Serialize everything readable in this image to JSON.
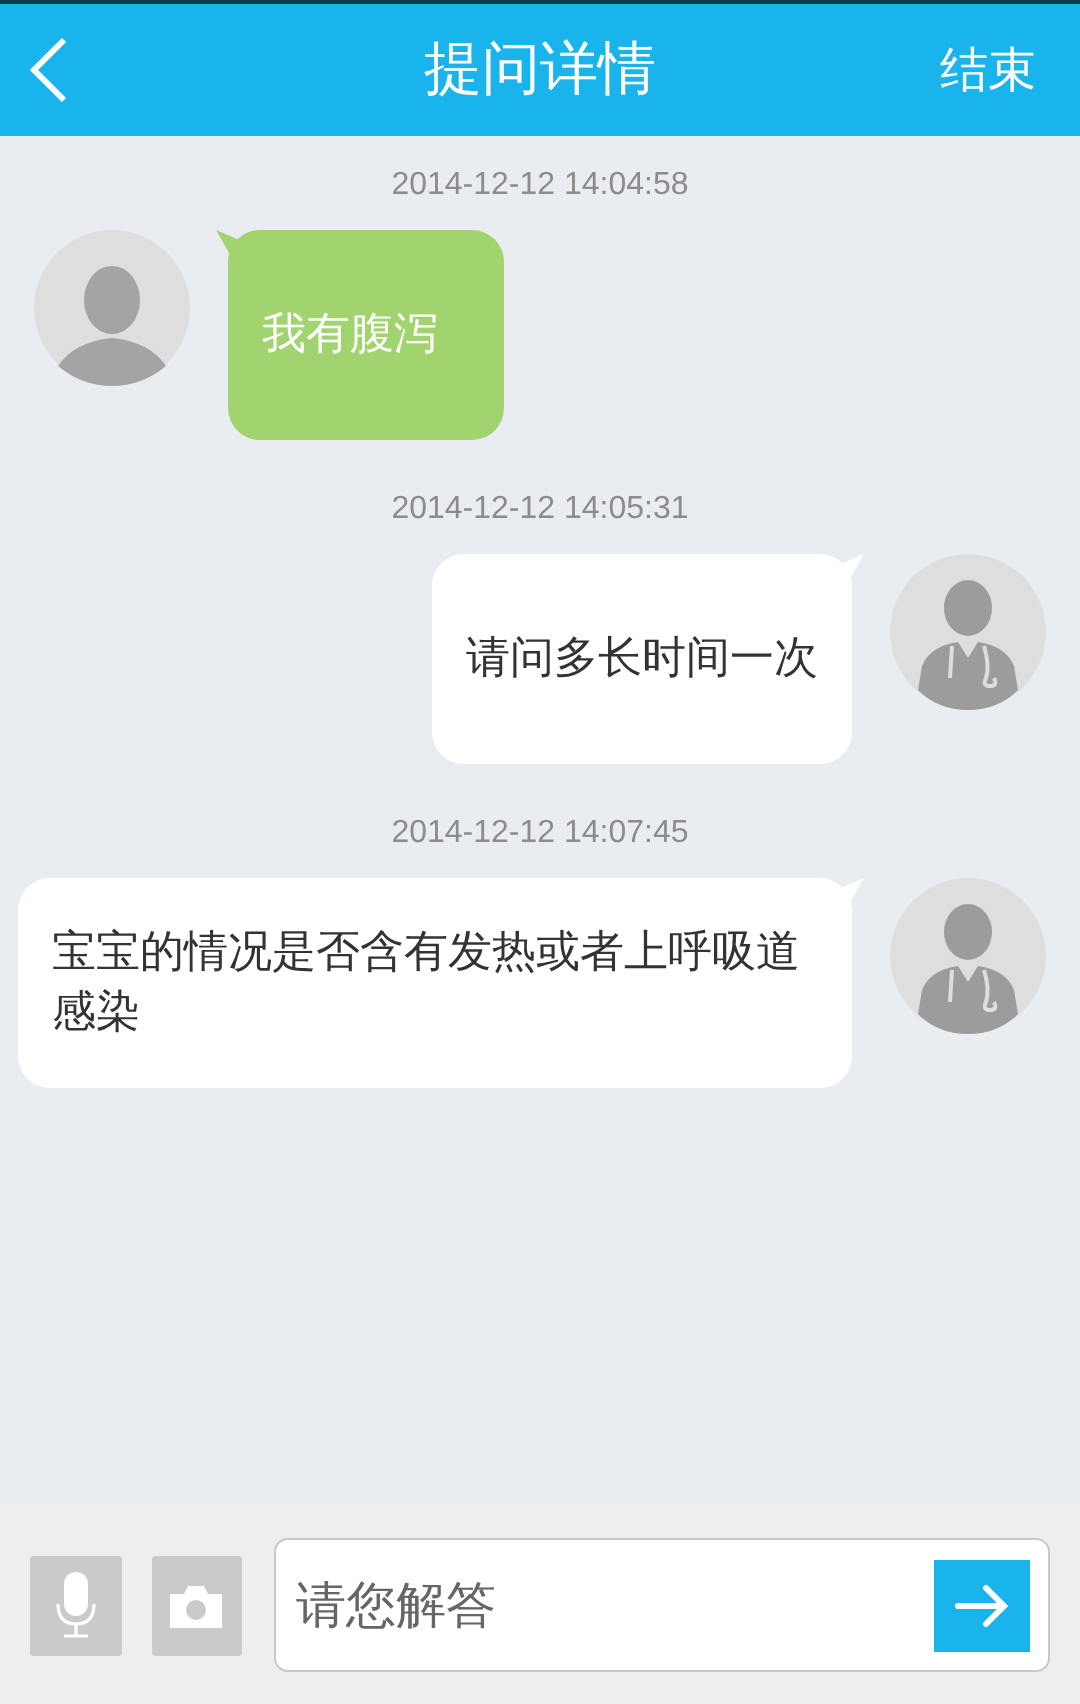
{
  "header": {
    "title": "提问详情",
    "action": "结束"
  },
  "messages": [
    {
      "time": "2014-12-12 14:04:58",
      "kind": "patient",
      "text": "我有腹泻"
    },
    {
      "time": "2014-12-12 14:05:31",
      "kind": "doctor",
      "text": "请问多长时间一次"
    },
    {
      "time": "2014-12-12 14:07:45",
      "kind": "doctor",
      "text": "宝宝的情况是否含有发热或者上呼吸道感染"
    }
  ],
  "composer": {
    "placeholder": "请您解答"
  }
}
